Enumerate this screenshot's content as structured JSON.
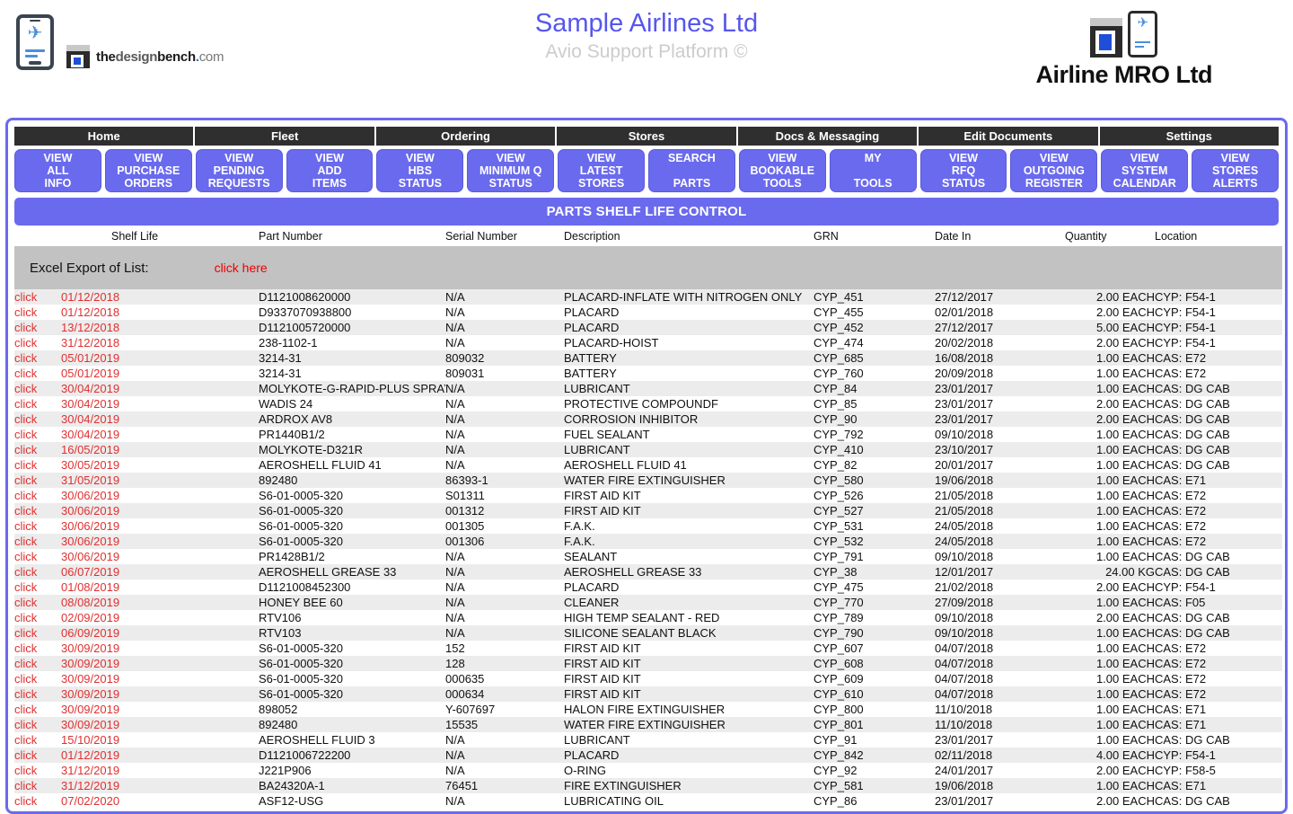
{
  "branding": {
    "left_logo_alt": "airline-app-phone-logo",
    "designbench": {
      "the": "the",
      "design": "design",
      "bench": "bench",
      "dot": ".",
      "com": "com"
    },
    "center_title": "Sample Airlines Ltd",
    "center_subtitle": "Avio Support Platform ©",
    "right_company": "Airline MRO Ltd"
  },
  "nav": {
    "tabs": [
      "Home",
      "Fleet",
      "Ordering",
      "Stores",
      "Docs & Messaging",
      "Edit Documents",
      "Settings"
    ],
    "buttons": [
      {
        "line1": "VIEW",
        "line2": "ALL",
        "line3": "INFO"
      },
      {
        "line1": "VIEW",
        "line2": "PURCHASE",
        "line3": "ORDERS"
      },
      {
        "line1": "VIEW",
        "line2": "PENDING",
        "line3": "REQUESTS"
      },
      {
        "line1": "VIEW",
        "line2": "ADD",
        "line3": "ITEMS"
      },
      {
        "line1": "VIEW",
        "line2": "HBS",
        "line3": "STATUS"
      },
      {
        "line1": "VIEW",
        "line2": "MINIMUM Q",
        "line3": "STATUS"
      },
      {
        "line1": "VIEW",
        "line2": "LATEST",
        "line3": "STORES"
      },
      {
        "line1": "SEARCH",
        "line2": "",
        "line3": "PARTS"
      },
      {
        "line1": "VIEW",
        "line2": "BOOKABLE",
        "line3": "TOOLS"
      },
      {
        "line1": "MY",
        "line2": "",
        "line3": "TOOLS"
      },
      {
        "line1": "VIEW",
        "line2": "RFQ",
        "line3": "STATUS"
      },
      {
        "line1": "VIEW",
        "line2": "OUTGOING",
        "line3": "REGISTER"
      },
      {
        "line1": "VIEW",
        "line2": "SYSTEM",
        "line3": "CALENDAR"
      },
      {
        "line1": "VIEW",
        "line2": "STORES",
        "line3": "ALERTS"
      }
    ]
  },
  "page": {
    "title": "PARTS SHELF LIFE CONTROL",
    "export_label": "Excel Export of List:",
    "export_link": "click here",
    "row_action_label": "click"
  },
  "colors": {
    "accent": "#6a6aee",
    "title_text": "#5656ee",
    "link_red": "#ee0000",
    "row_red": "#e03030",
    "tab_bar": "#2f2f2f",
    "export_bar": "#c2c2c2",
    "row_alt": "#ececec"
  },
  "table": {
    "columns": [
      "",
      "Shelf Life",
      "Part Number",
      "Serial Number",
      "Description",
      "GRN",
      "Date In",
      "Quantity",
      "Location"
    ],
    "rows": [
      {
        "shelf_life": "01/12/2018",
        "part_number": "D1121008620000",
        "serial_number": "N/A",
        "description": "PLACARD-INFLATE WITH NITROGEN ONLY",
        "grn": "CYP_451",
        "date_in": "27/12/2017",
        "quantity": "2.00 EACH",
        "location": "CYP: F54-1"
      },
      {
        "shelf_life": "01/12/2018",
        "part_number": "D9337070938800",
        "serial_number": "N/A",
        "description": "PLACARD",
        "grn": "CYP_455",
        "date_in": "02/01/2018",
        "quantity": "2.00 EACH",
        "location": "CYP: F54-1"
      },
      {
        "shelf_life": "13/12/2018",
        "part_number": "D1121005720000",
        "serial_number": "N/A",
        "description": "PLACARD",
        "grn": "CYP_452",
        "date_in": "27/12/2017",
        "quantity": "5.00 EACH",
        "location": "CYP: F54-1"
      },
      {
        "shelf_life": "31/12/2018",
        "part_number": "238-1102-1",
        "serial_number": "N/A",
        "description": "PLACARD-HOIST",
        "grn": "CYP_474",
        "date_in": "20/02/2018",
        "quantity": "2.00 EACH",
        "location": "CYP: F54-1"
      },
      {
        "shelf_life": "05/01/2019",
        "part_number": "3214-31",
        "serial_number": "809032",
        "description": "BATTERY",
        "grn": "CYP_685",
        "date_in": "16/08/2018",
        "quantity": "1.00 EACH",
        "location": "CAS: E72"
      },
      {
        "shelf_life": "05/01/2019",
        "part_number": "3214-31",
        "serial_number": "809031",
        "description": "BATTERY",
        "grn": "CYP_760",
        "date_in": "20/09/2018",
        "quantity": "1.00 EACH",
        "location": "CAS: E72"
      },
      {
        "shelf_life": "30/04/2019",
        "part_number": "MOLYKOTE-G-RAPID-PLUS SPRAY",
        "serial_number": "N/A",
        "description": "LUBRICANT",
        "grn": "CYP_84",
        "date_in": "23/01/2017",
        "quantity": "1.00 EACH",
        "location": "CAS: DG CAB",
        "tall": true
      },
      {
        "shelf_life": "30/04/2019",
        "part_number": "WADIS 24",
        "serial_number": "N/A",
        "description": "PROTECTIVE COMPOUNDF",
        "grn": "CYP_85",
        "date_in": "23/01/2017",
        "quantity": "2.00 EACH",
        "location": "CAS: DG CAB"
      },
      {
        "shelf_life": "30/04/2019",
        "part_number": "ARDROX AV8",
        "serial_number": "N/A",
        "description": "CORROSION INHIBITOR",
        "grn": "CYP_90",
        "date_in": "23/01/2017",
        "quantity": "2.00 EACH",
        "location": "CAS: DG CAB"
      },
      {
        "shelf_life": "30/04/2019",
        "part_number": "PR1440B1/2",
        "serial_number": "N/A",
        "description": "FUEL SEALANT",
        "grn": "CYP_792",
        "date_in": "09/10/2018",
        "quantity": "1.00 EACH",
        "location": "CAS: DG CAB"
      },
      {
        "shelf_life": "16/05/2019",
        "part_number": "MOLYKOTE-D321R",
        "serial_number": "N/A",
        "description": "LUBRICANT",
        "grn": "CYP_410",
        "date_in": "23/10/2017",
        "quantity": "1.00 EACH",
        "location": "CAS: DG CAB"
      },
      {
        "shelf_life": "30/05/2019",
        "part_number": "AEROSHELL FLUID 41",
        "serial_number": "N/A",
        "description": "AEROSHELL FLUID 41",
        "grn": "CYP_82",
        "date_in": "20/01/2017",
        "quantity": "1.00 EACH",
        "location": "CAS: DG CAB"
      },
      {
        "shelf_life": "31/05/2019",
        "part_number": "892480",
        "serial_number": "86393-1",
        "description": "WATER FIRE EXTINGUISHER",
        "grn": "CYP_580",
        "date_in": "19/06/2018",
        "quantity": "1.00 EACH",
        "location": "CAS: E71"
      },
      {
        "shelf_life": "30/06/2019",
        "part_number": "S6-01-0005-320",
        "serial_number": "S01311",
        "description": "FIRST AID KIT",
        "grn": "CYP_526",
        "date_in": "21/05/2018",
        "quantity": "1.00 EACH",
        "location": "CAS: E72"
      },
      {
        "shelf_life": "30/06/2019",
        "part_number": "S6-01-0005-320",
        "serial_number": "001312",
        "description": "FIRST AID KIT",
        "grn": "CYP_527",
        "date_in": "21/05/2018",
        "quantity": "1.00 EACH",
        "location": "CAS: E72"
      },
      {
        "shelf_life": "30/06/2019",
        "part_number": "S6-01-0005-320",
        "serial_number": "001305",
        "description": "F.A.K.",
        "grn": "CYP_531",
        "date_in": "24/05/2018",
        "quantity": "1.00 EACH",
        "location": "CAS: E72"
      },
      {
        "shelf_life": "30/06/2019",
        "part_number": "S6-01-0005-320",
        "serial_number": "001306",
        "description": "F.A.K.",
        "grn": "CYP_532",
        "date_in": "24/05/2018",
        "quantity": "1.00 EACH",
        "location": "CAS: E72"
      },
      {
        "shelf_life": "30/06/2019",
        "part_number": "PR1428B1/2",
        "serial_number": "N/A",
        "description": "SEALANT",
        "grn": "CYP_791",
        "date_in": "09/10/2018",
        "quantity": "1.00 EACH",
        "location": "CAS: DG CAB"
      },
      {
        "shelf_life": "06/07/2019",
        "part_number": "AEROSHELL GREASE 33",
        "serial_number": "N/A",
        "description": "AEROSHELL GREASE 33",
        "grn": "CYP_38",
        "date_in": "12/01/2017",
        "quantity": "24.00 KG",
        "location": "CAS: DG CAB"
      },
      {
        "shelf_life": "01/08/2019",
        "part_number": "D1121008452300",
        "serial_number": "N/A",
        "description": "PLACARD",
        "grn": "CYP_475",
        "date_in": "21/02/2018",
        "quantity": "2.00 EACH",
        "location": "CYP: F54-1"
      },
      {
        "shelf_life": "08/08/2019",
        "part_number": "HONEY BEE 60",
        "serial_number": "N/A",
        "description": "CLEANER",
        "grn": "CYP_770",
        "date_in": "27/09/2018",
        "quantity": "1.00 EACH",
        "location": "CAS: F05"
      },
      {
        "shelf_life": "02/09/2019",
        "part_number": "RTV106",
        "serial_number": "N/A",
        "description": "HIGH TEMP SEALANT - RED",
        "grn": "CYP_789",
        "date_in": "09/10/2018",
        "quantity": "2.00 EACH",
        "location": "CAS: DG CAB"
      },
      {
        "shelf_life": "06/09/2019",
        "part_number": "RTV103",
        "serial_number": "N/A",
        "description": "SILICONE SEALANT BLACK",
        "grn": "CYP_790",
        "date_in": "09/10/2018",
        "quantity": "1.00 EACH",
        "location": "CAS: DG CAB"
      },
      {
        "shelf_life": "30/09/2019",
        "part_number": "S6-01-0005-320",
        "serial_number": "152",
        "description": "FIRST AID KIT",
        "grn": "CYP_607",
        "date_in": "04/07/2018",
        "quantity": "1.00 EACH",
        "location": "CAS: E72"
      },
      {
        "shelf_life": "30/09/2019",
        "part_number": "S6-01-0005-320",
        "serial_number": "128",
        "description": "FIRST AID KIT",
        "grn": "CYP_608",
        "date_in": "04/07/2018",
        "quantity": "1.00 EACH",
        "location": "CAS: E72"
      },
      {
        "shelf_life": "30/09/2019",
        "part_number": "S6-01-0005-320",
        "serial_number": "000635",
        "description": "FIRST AID KIT",
        "grn": "CYP_609",
        "date_in": "04/07/2018",
        "quantity": "1.00 EACH",
        "location": "CAS: E72"
      },
      {
        "shelf_life": "30/09/2019",
        "part_number": "S6-01-0005-320",
        "serial_number": "000634",
        "description": "FIRST AID KIT",
        "grn": "CYP_610",
        "date_in": "04/07/2018",
        "quantity": "1.00 EACH",
        "location": "CAS: E72"
      },
      {
        "shelf_life": "30/09/2019",
        "part_number": "898052",
        "serial_number": "Y-607697",
        "description": "HALON FIRE EXTINGUISHER",
        "grn": "CYP_800",
        "date_in": "11/10/2018",
        "quantity": "1.00 EACH",
        "location": "CAS: E71"
      },
      {
        "shelf_life": "30/09/2019",
        "part_number": "892480",
        "serial_number": "15535",
        "description": "WATER FIRE EXTINGUISHER",
        "grn": "CYP_801",
        "date_in": "11/10/2018",
        "quantity": "1.00 EACH",
        "location": "CAS: E71"
      },
      {
        "shelf_life": "15/10/2019",
        "part_number": "AEROSHELL FLUID 3",
        "serial_number": "N/A",
        "description": "LUBRICANT",
        "grn": "CYP_91",
        "date_in": "23/01/2017",
        "quantity": "1.00 EACH",
        "location": "CAS: DG CAB"
      },
      {
        "shelf_life": "01/12/2019",
        "part_number": "D1121006722200",
        "serial_number": "N/A",
        "description": "PLACARD",
        "grn": "CYP_842",
        "date_in": "02/11/2018",
        "quantity": "4.00 EACH",
        "location": "CYP: F54-1"
      },
      {
        "shelf_life": "31/12/2019",
        "part_number": "J221P906",
        "serial_number": "N/A",
        "description": "O-RING",
        "grn": "CYP_92",
        "date_in": "24/01/2017",
        "quantity": "2.00 EACH",
        "location": "CYP: F58-5"
      },
      {
        "shelf_life": "31/12/2019",
        "part_number": "BA24320A-1",
        "serial_number": "76451",
        "description": "FIRE EXTINGUISHER",
        "grn": "CYP_581",
        "date_in": "19/06/2018",
        "quantity": "1.00 EACH",
        "location": "CAS: E71"
      },
      {
        "shelf_life": "07/02/2020",
        "part_number": "ASF12-USG",
        "serial_number": "N/A",
        "description": "LUBRICATING OIL",
        "grn": "CYP_86",
        "date_in": "23/01/2017",
        "quantity": "2.00 EACH",
        "location": "CAS: DG CAB"
      }
    ]
  }
}
